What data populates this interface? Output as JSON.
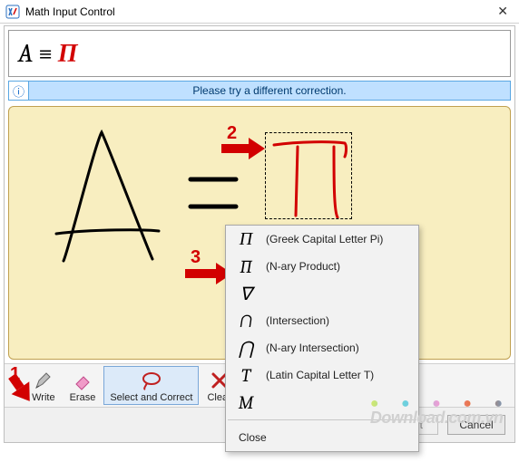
{
  "titlebar": {
    "title": "Math Input Control"
  },
  "preview": {
    "a": "A",
    "equiv": "≡",
    "pi": "Π"
  },
  "message": {
    "text": "Please try a different correction."
  },
  "annotations": {
    "n1": "1",
    "n2": "2",
    "n3": "3"
  },
  "popup": {
    "items": [
      {
        "sym": "Π",
        "desc": "(Greek Capital Letter Pi)"
      },
      {
        "sym": "∏",
        "desc": "(N-ary Product)"
      },
      {
        "sym": "∇",
        "desc": ""
      },
      {
        "sym": "∩",
        "desc": "(Intersection)"
      },
      {
        "sym": "⋂",
        "desc": "(N-ary Intersection)"
      },
      {
        "sym": "T",
        "desc": "(Latin Capital Letter T)"
      },
      {
        "sym": "M",
        "desc": ""
      }
    ],
    "close": "Close"
  },
  "toolbar": {
    "write": "Write",
    "erase": "Erase",
    "select_correct": "Select and Correct",
    "clear": "Clear"
  },
  "buttons": {
    "insert": "Insert",
    "cancel": "Cancel"
  },
  "watermark": "Download.com.vn"
}
